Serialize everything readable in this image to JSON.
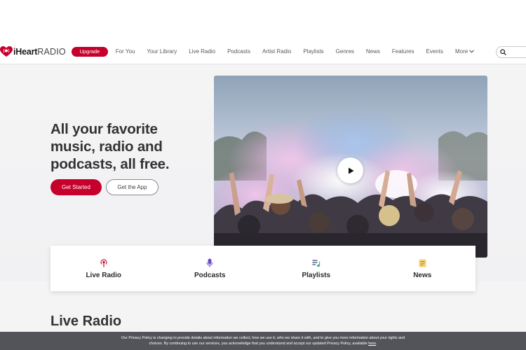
{
  "header": {
    "logo_bold": "iHeart",
    "logo_thin": "RADIO",
    "upgrade_label": "Upgrade",
    "nav": [
      "For You",
      "Your Library",
      "Live Radio",
      "Podcasts",
      "Artist Radio",
      "Playlists",
      "Genres",
      "News",
      "Features",
      "Events"
    ],
    "more_label": "More"
  },
  "hero": {
    "headline": "All your favorite music, radio and podcasts, all free.",
    "cta_primary": "Get Started",
    "cta_secondary": "Get the App"
  },
  "categories": [
    {
      "label": "Live Radio",
      "icon": "radio-icon"
    },
    {
      "label": "Podcasts",
      "icon": "microphone-icon"
    },
    {
      "label": "Playlists",
      "icon": "playlist-icon"
    },
    {
      "label": "News",
      "icon": "news-icon"
    }
  ],
  "section": {
    "title": "Live Radio"
  },
  "privacy": {
    "line1": "Our Privacy Policy is changing to provide details about information we collect, how we use it, who we share it with, and to give you more information about your rights and",
    "line2": "choices. By continuing to use our services, you acknowledge that you understand and accept our updated Privacy Policy, available",
    "link": "here",
    "end": "."
  },
  "colors": {
    "brand_red": "#c6002b",
    "text_dark": "#333333",
    "privacy_bg": "#53535a"
  }
}
